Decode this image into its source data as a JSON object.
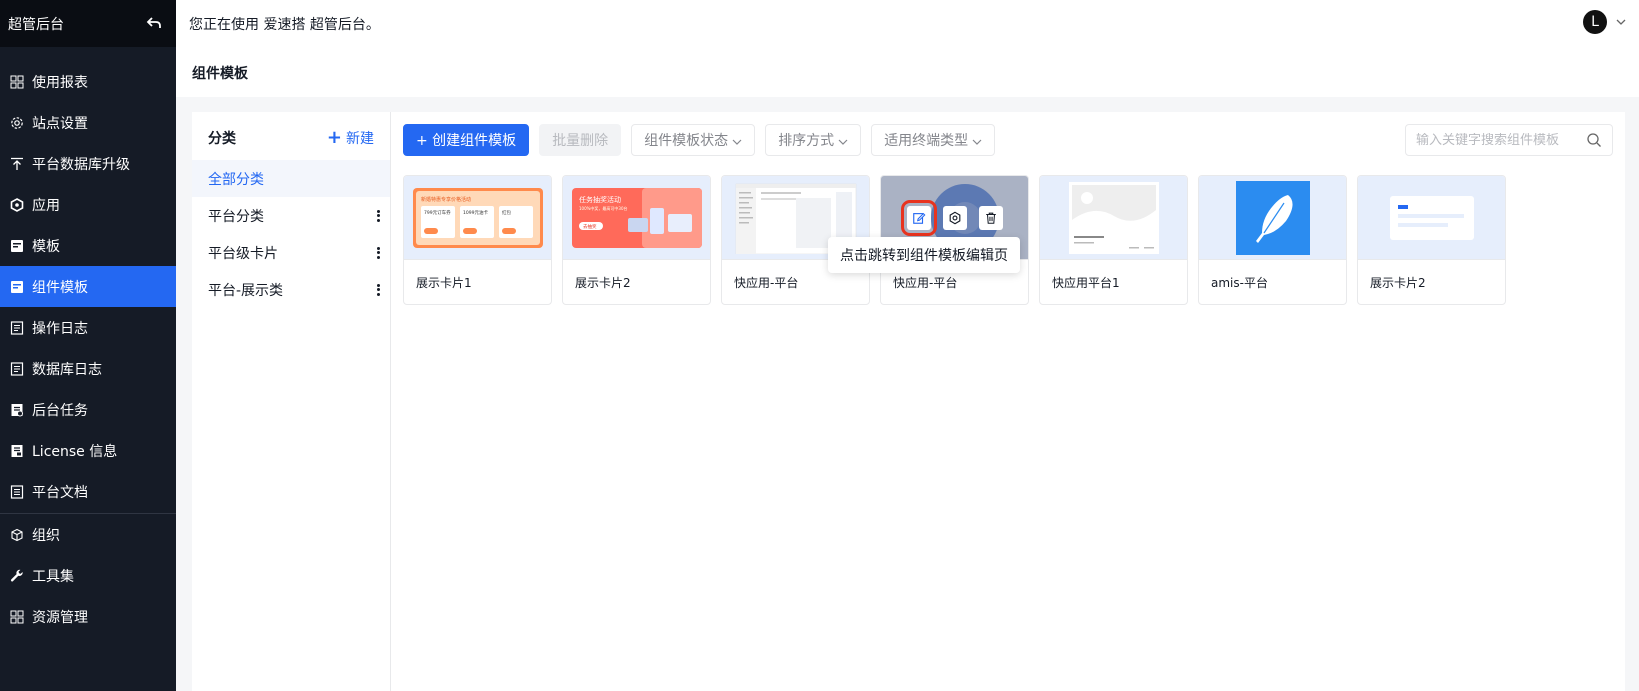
{
  "sidebar": {
    "brand": "超管后台",
    "items": [
      {
        "label": "使用报表",
        "icon": "grid-icon"
      },
      {
        "label": "站点设置",
        "icon": "gear-icon"
      },
      {
        "label": "平台数据库升级",
        "icon": "upload-icon"
      },
      {
        "label": "应用",
        "icon": "hexagon-icon"
      },
      {
        "label": "模板",
        "icon": "template-icon"
      },
      {
        "label": "组件模板",
        "icon": "template-icon",
        "active": true
      },
      {
        "label": "操作日志",
        "icon": "log-icon"
      },
      {
        "label": "数据库日志",
        "icon": "log-icon"
      },
      {
        "label": "后台任务",
        "icon": "task-icon"
      },
      {
        "label": "License 信息",
        "icon": "license-icon"
      },
      {
        "label": "平台文档",
        "icon": "doc-icon"
      },
      {
        "label": "组织",
        "icon": "cube-icon"
      },
      {
        "label": "工具集",
        "icon": "wrench-icon"
      },
      {
        "label": "资源管理",
        "icon": "grid-icon"
      }
    ]
  },
  "header": {
    "message": "您正在使用 爱速搭 超管后台。",
    "avatar_letter": "L"
  },
  "page": {
    "title": "组件模板"
  },
  "categories": {
    "title": "分类",
    "new_label": "新建",
    "items": [
      {
        "label": "全部分类",
        "selected": true
      },
      {
        "label": "平台分类"
      },
      {
        "label": "平台级卡片"
      },
      {
        "label": "平台-展示类"
      }
    ]
  },
  "toolbar": {
    "create_label": "+ 创建组件模板",
    "batch_delete_label": "批量删除",
    "status_filter": "组件模板状态",
    "sort_filter": "排序方式",
    "terminal_filter": "适用终端类型"
  },
  "search": {
    "placeholder": "输入关键字搜索组件模板"
  },
  "cards": [
    {
      "name": "展示卡片1"
    },
    {
      "name": "展示卡片2"
    },
    {
      "name": "快应用-平台"
    },
    {
      "name": "快应用-平台"
    },
    {
      "name": "快应用平台1"
    },
    {
      "name": "amis-平台"
    },
    {
      "name": "展示卡片2"
    }
  ],
  "thumb_text": {
    "card1_title": "新婚特惠专享价格活动",
    "card1_a": "799元订车券",
    "card1_b": "1099元油卡",
    "card1_c": "红包",
    "card2_title": "任务抽奖活动",
    "card2_sub": "100%中奖，最高可中30台",
    "card2_btn": "去抽奖"
  },
  "tooltip": {
    "text": "点击跳转到组件模板编辑页"
  },
  "colors": {
    "primary": "#2468f2",
    "sidebar_bg": "#151b26",
    "highlight": "#e8331f"
  }
}
